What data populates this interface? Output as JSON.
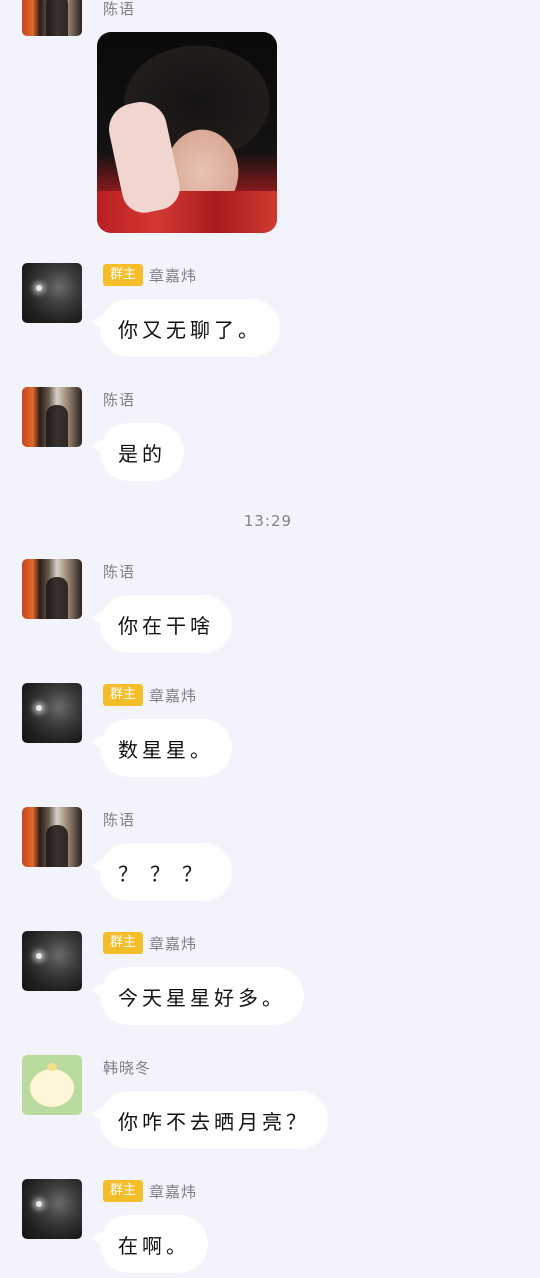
{
  "messages": [
    {
      "sender": "陈语",
      "is_owner": false,
      "type": "image"
    },
    {
      "sender": "章嘉炜",
      "is_owner": true,
      "badge": "群主",
      "text": "你又无聊了。"
    },
    {
      "sender": "陈语",
      "is_owner": false,
      "text": "是的"
    },
    {
      "sender": "陈语",
      "is_owner": false,
      "text": "你在干啥"
    },
    {
      "sender": "章嘉炜",
      "is_owner": true,
      "badge": "群主",
      "text": "数星星。"
    },
    {
      "sender": "陈语",
      "is_owner": false,
      "text": "？？？"
    },
    {
      "sender": "章嘉炜",
      "is_owner": true,
      "badge": "群主",
      "text": "今天星星好多。"
    },
    {
      "sender": "韩晓冬",
      "is_owner": false,
      "text": "你咋不去晒月亮？"
    },
    {
      "sender": "章嘉炜",
      "is_owner": true,
      "badge": "群主",
      "text": "在啊。"
    }
  ],
  "timestamp": "13:29",
  "colors": {
    "background": "#f3f4fb",
    "bubble": "#ffffff",
    "owner_badge": "#f6bd2a",
    "name_text": "#7d7f86"
  }
}
